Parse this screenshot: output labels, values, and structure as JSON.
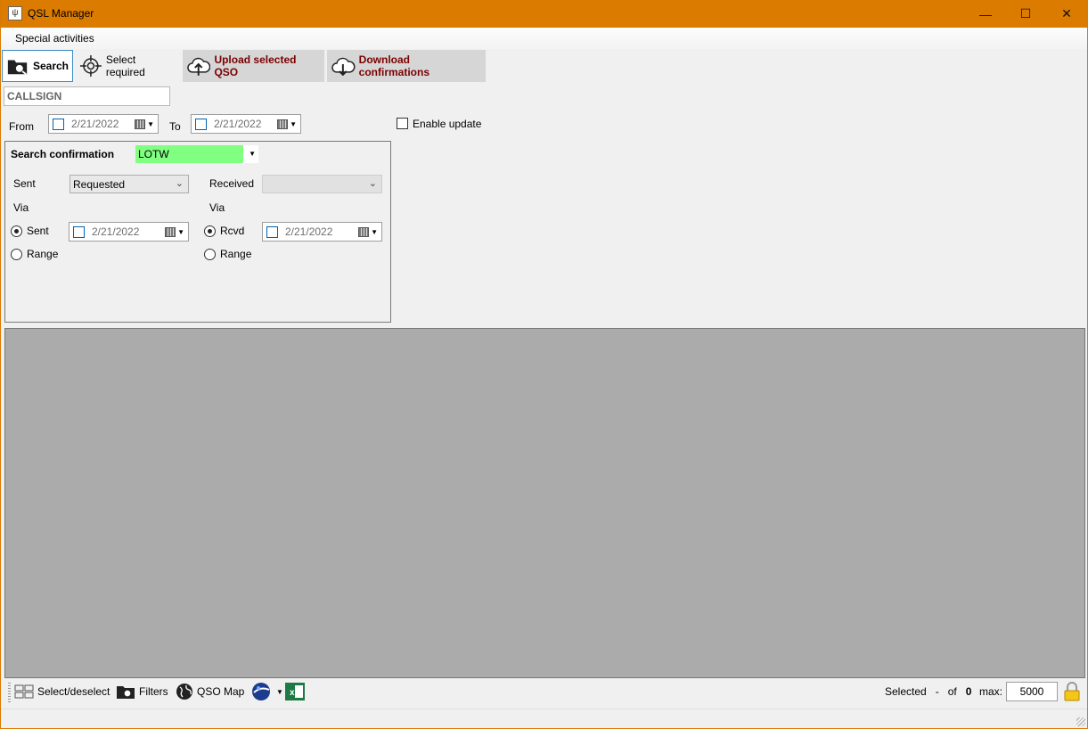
{
  "window": {
    "title": "QSL Manager",
    "minimize": "—",
    "maximize": "☐",
    "close": "✕"
  },
  "menu": {
    "special_activities": "Special activities"
  },
  "toolbar": {
    "search": "Search",
    "select_required": "Select required",
    "upload": "Upload selected QSO",
    "download": "Download confirmations"
  },
  "filters": {
    "callsign_value": "CALLSIGN",
    "from_label": "From",
    "from_date": "2/21/2022",
    "to_label": "To",
    "to_date": "2/21/2022",
    "enable_update": "Enable update"
  },
  "confirmation": {
    "title": "Search confirmation",
    "service": "LOTW",
    "sent_label": "Sent",
    "sent_value": "Requested",
    "received_label": "Received",
    "received_value": "",
    "via_left": "Via",
    "via_right": "Via",
    "sent_radio": "Sent",
    "sent_date": "2/21/2022",
    "range_left": "Range",
    "rcvd_radio": "Rcvd",
    "rcvd_date": "2/21/2022",
    "range_right": "Range"
  },
  "bottom": {
    "select_deselect": "Select/deselect",
    "filters": "Filters",
    "qso_map": "QSO Map",
    "selected_label": "Selected",
    "selected_count": "-",
    "of_label": "of",
    "total_count": "0",
    "max_label": "max:",
    "max_value": "5000"
  },
  "colors": {
    "titlebar": "#db7b00",
    "service_highlight": "#80ff80",
    "action_text": "#7a0000"
  }
}
